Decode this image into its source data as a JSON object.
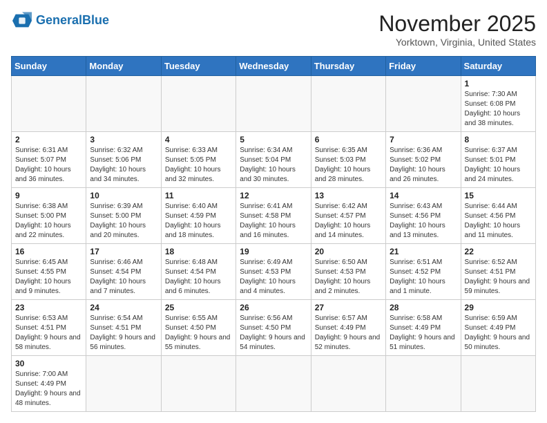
{
  "header": {
    "logo_general": "General",
    "logo_blue": "Blue",
    "month": "November 2025",
    "location": "Yorktown, Virginia, United States"
  },
  "weekdays": [
    "Sunday",
    "Monday",
    "Tuesday",
    "Wednesday",
    "Thursday",
    "Friday",
    "Saturday"
  ],
  "weeks": [
    [
      {
        "day": "",
        "info": ""
      },
      {
        "day": "",
        "info": ""
      },
      {
        "day": "",
        "info": ""
      },
      {
        "day": "",
        "info": ""
      },
      {
        "day": "",
        "info": ""
      },
      {
        "day": "",
        "info": ""
      },
      {
        "day": "1",
        "info": "Sunrise: 7:30 AM\nSunset: 6:08 PM\nDaylight: 10 hours\nand 38 minutes."
      }
    ],
    [
      {
        "day": "2",
        "info": "Sunrise: 6:31 AM\nSunset: 5:07 PM\nDaylight: 10 hours\nand 36 minutes."
      },
      {
        "day": "3",
        "info": "Sunrise: 6:32 AM\nSunset: 5:06 PM\nDaylight: 10 hours\nand 34 minutes."
      },
      {
        "day": "4",
        "info": "Sunrise: 6:33 AM\nSunset: 5:05 PM\nDaylight: 10 hours\nand 32 minutes."
      },
      {
        "day": "5",
        "info": "Sunrise: 6:34 AM\nSunset: 5:04 PM\nDaylight: 10 hours\nand 30 minutes."
      },
      {
        "day": "6",
        "info": "Sunrise: 6:35 AM\nSunset: 5:03 PM\nDaylight: 10 hours\nand 28 minutes."
      },
      {
        "day": "7",
        "info": "Sunrise: 6:36 AM\nSunset: 5:02 PM\nDaylight: 10 hours\nand 26 minutes."
      },
      {
        "day": "8",
        "info": "Sunrise: 6:37 AM\nSunset: 5:01 PM\nDaylight: 10 hours\nand 24 minutes."
      }
    ],
    [
      {
        "day": "9",
        "info": "Sunrise: 6:38 AM\nSunset: 5:00 PM\nDaylight: 10 hours\nand 22 minutes."
      },
      {
        "day": "10",
        "info": "Sunrise: 6:39 AM\nSunset: 5:00 PM\nDaylight: 10 hours\nand 20 minutes."
      },
      {
        "day": "11",
        "info": "Sunrise: 6:40 AM\nSunset: 4:59 PM\nDaylight: 10 hours\nand 18 minutes."
      },
      {
        "day": "12",
        "info": "Sunrise: 6:41 AM\nSunset: 4:58 PM\nDaylight: 10 hours\nand 16 minutes."
      },
      {
        "day": "13",
        "info": "Sunrise: 6:42 AM\nSunset: 4:57 PM\nDaylight: 10 hours\nand 14 minutes."
      },
      {
        "day": "14",
        "info": "Sunrise: 6:43 AM\nSunset: 4:56 PM\nDaylight: 10 hours\nand 13 minutes."
      },
      {
        "day": "15",
        "info": "Sunrise: 6:44 AM\nSunset: 4:56 PM\nDaylight: 10 hours\nand 11 minutes."
      }
    ],
    [
      {
        "day": "16",
        "info": "Sunrise: 6:45 AM\nSunset: 4:55 PM\nDaylight: 10 hours\nand 9 minutes."
      },
      {
        "day": "17",
        "info": "Sunrise: 6:46 AM\nSunset: 4:54 PM\nDaylight: 10 hours\nand 7 minutes."
      },
      {
        "day": "18",
        "info": "Sunrise: 6:48 AM\nSunset: 4:54 PM\nDaylight: 10 hours\nand 6 minutes."
      },
      {
        "day": "19",
        "info": "Sunrise: 6:49 AM\nSunset: 4:53 PM\nDaylight: 10 hours\nand 4 minutes."
      },
      {
        "day": "20",
        "info": "Sunrise: 6:50 AM\nSunset: 4:53 PM\nDaylight: 10 hours\nand 2 minutes."
      },
      {
        "day": "21",
        "info": "Sunrise: 6:51 AM\nSunset: 4:52 PM\nDaylight: 10 hours\nand 1 minute."
      },
      {
        "day": "22",
        "info": "Sunrise: 6:52 AM\nSunset: 4:51 PM\nDaylight: 9 hours\nand 59 minutes."
      }
    ],
    [
      {
        "day": "23",
        "info": "Sunrise: 6:53 AM\nSunset: 4:51 PM\nDaylight: 9 hours\nand 58 minutes."
      },
      {
        "day": "24",
        "info": "Sunrise: 6:54 AM\nSunset: 4:51 PM\nDaylight: 9 hours\nand 56 minutes."
      },
      {
        "day": "25",
        "info": "Sunrise: 6:55 AM\nSunset: 4:50 PM\nDaylight: 9 hours\nand 55 minutes."
      },
      {
        "day": "26",
        "info": "Sunrise: 6:56 AM\nSunset: 4:50 PM\nDaylight: 9 hours\nand 54 minutes."
      },
      {
        "day": "27",
        "info": "Sunrise: 6:57 AM\nSunset: 4:49 PM\nDaylight: 9 hours\nand 52 minutes."
      },
      {
        "day": "28",
        "info": "Sunrise: 6:58 AM\nSunset: 4:49 PM\nDaylight: 9 hours\nand 51 minutes."
      },
      {
        "day": "29",
        "info": "Sunrise: 6:59 AM\nSunset: 4:49 PM\nDaylight: 9 hours\nand 50 minutes."
      }
    ],
    [
      {
        "day": "30",
        "info": "Sunrise: 7:00 AM\nSunset: 4:49 PM\nDaylight: 9 hours\nand 48 minutes."
      },
      {
        "day": "",
        "info": ""
      },
      {
        "day": "",
        "info": ""
      },
      {
        "day": "",
        "info": ""
      },
      {
        "day": "",
        "info": ""
      },
      {
        "day": "",
        "info": ""
      },
      {
        "day": "",
        "info": ""
      }
    ]
  ]
}
